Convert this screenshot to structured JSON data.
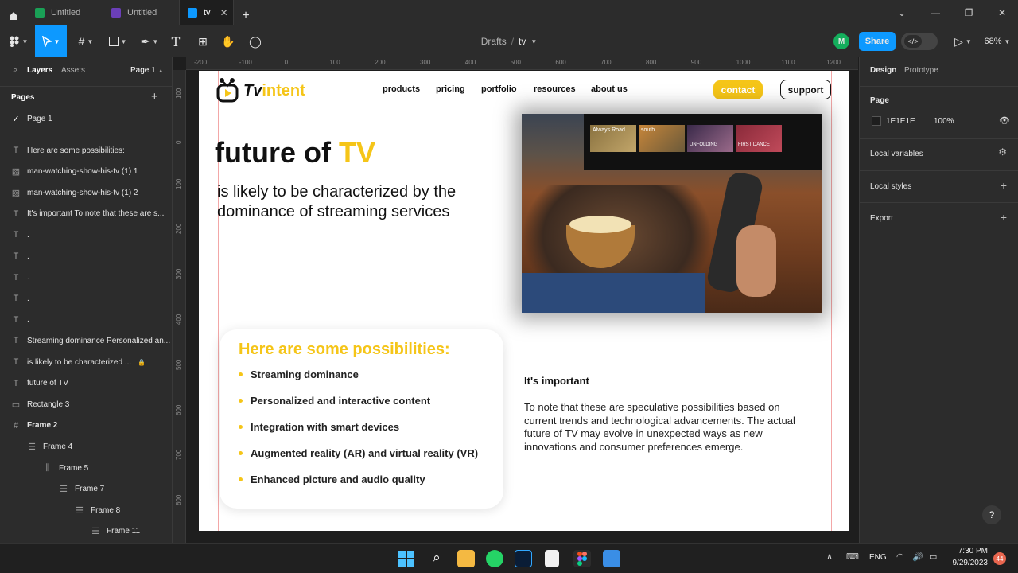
{
  "titlebar": {
    "tabs": [
      {
        "label": "Untitled"
      },
      {
        "label": "Untitled"
      },
      {
        "label": "tv"
      }
    ],
    "new_tab": "+"
  },
  "toolbar": {
    "breadcrumb_parent": "Drafts",
    "breadcrumb_sep": "/",
    "file_name": "tv",
    "avatar_initial": "M",
    "share_label": "Share",
    "zoom": "68%"
  },
  "left_panel": {
    "tab_layers": "Layers",
    "tab_assets": "Assets",
    "page_selector": "Page 1",
    "pages_header": "Pages",
    "pages": [
      "Page 1"
    ],
    "layers": [
      {
        "icon": "text",
        "label": "Here are some possibilities:",
        "indent": 0
      },
      {
        "icon": "image",
        "label": "man-watching-show-his-tv (1) 1",
        "indent": 0
      },
      {
        "icon": "image",
        "label": "man-watching-show-his-tv (1) 2",
        "indent": 0
      },
      {
        "icon": "text",
        "label": "It's important To note that these are s...",
        "indent": 0
      },
      {
        "icon": "text",
        "label": ".",
        "indent": 0
      },
      {
        "icon": "text",
        "label": ".",
        "indent": 0
      },
      {
        "icon": "text",
        "label": ".",
        "indent": 0
      },
      {
        "icon": "text",
        "label": ".",
        "indent": 0
      },
      {
        "icon": "text",
        "label": ".",
        "indent": 0
      },
      {
        "icon": "text",
        "label": "Streaming dominance Personalized an...",
        "indent": 0
      },
      {
        "icon": "text",
        "label": "is likely to be characterized ...",
        "indent": 0
      },
      {
        "icon": "text",
        "label": "future of TV",
        "indent": 0
      },
      {
        "icon": "rect",
        "label": "Rectangle 3",
        "indent": 0
      },
      {
        "icon": "frame",
        "label": "Frame 2",
        "indent": 0
      },
      {
        "icon": "autolayout",
        "label": "Frame 4",
        "indent": 1
      },
      {
        "icon": "autolayout-h",
        "label": "Frame 5",
        "indent": 2
      },
      {
        "icon": "autolayout",
        "label": "Frame 7",
        "indent": 3
      },
      {
        "icon": "autolayout",
        "label": "Frame 8",
        "indent": 4
      },
      {
        "icon": "autolayout",
        "label": "Frame 11",
        "indent": 5
      }
    ]
  },
  "ruler": {
    "top": [
      "-200",
      "-100",
      "0",
      "100",
      "200",
      "300",
      "400",
      "500",
      "600",
      "700",
      "800",
      "900",
      "1000",
      "1100",
      "1200"
    ],
    "left": [
      "100",
      "0",
      "100",
      "200",
      "300",
      "400",
      "500",
      "600",
      "700",
      "800"
    ]
  },
  "design": {
    "logo_text_a": "Tv",
    "logo_text_b": "intent",
    "nav": [
      "products",
      "pricing",
      "portfolio",
      "resources",
      "about us"
    ],
    "contact_label": "contact",
    "support_label": "support",
    "hero_title_a": "future of ",
    "hero_title_b": "TV",
    "hero_subtitle": "is likely to be characterized by the dominance of streaming services",
    "tv_tiles": [
      "Always Road",
      "south",
      "UNFOLDING",
      "FIRST DANCE"
    ],
    "possibilities_title": "Here are some possibilities:",
    "possibilities": [
      "Streaming dominance",
      "Personalized and interactive content",
      "Integration with smart devices",
      "Augmented reality (AR) and virtual reality (VR)",
      "Enhanced picture and audio quality"
    ],
    "important_title": "It's important",
    "important_body": "To note that these are speculative possibilities based on current trends and technological advancements. The actual future of TV may evolve in unexpected ways as new innovations and consumer preferences emerge."
  },
  "right_panel": {
    "tab_design": "Design",
    "tab_prototype": "Prototype",
    "page_label": "Page",
    "page_color": "1E1E1E",
    "page_opacity": "100%",
    "local_variables": "Local variables",
    "local_styles": "Local styles",
    "export": "Export",
    "help": "?"
  },
  "taskbar": {
    "lang": "ENG",
    "time": "7:30 PM",
    "date": "9/29/2023",
    "notif_count": "44"
  },
  "colors": {
    "accent_yellow": "#f5c518",
    "share_blue": "#0d99ff",
    "avatar_green": "#14ae5c"
  }
}
